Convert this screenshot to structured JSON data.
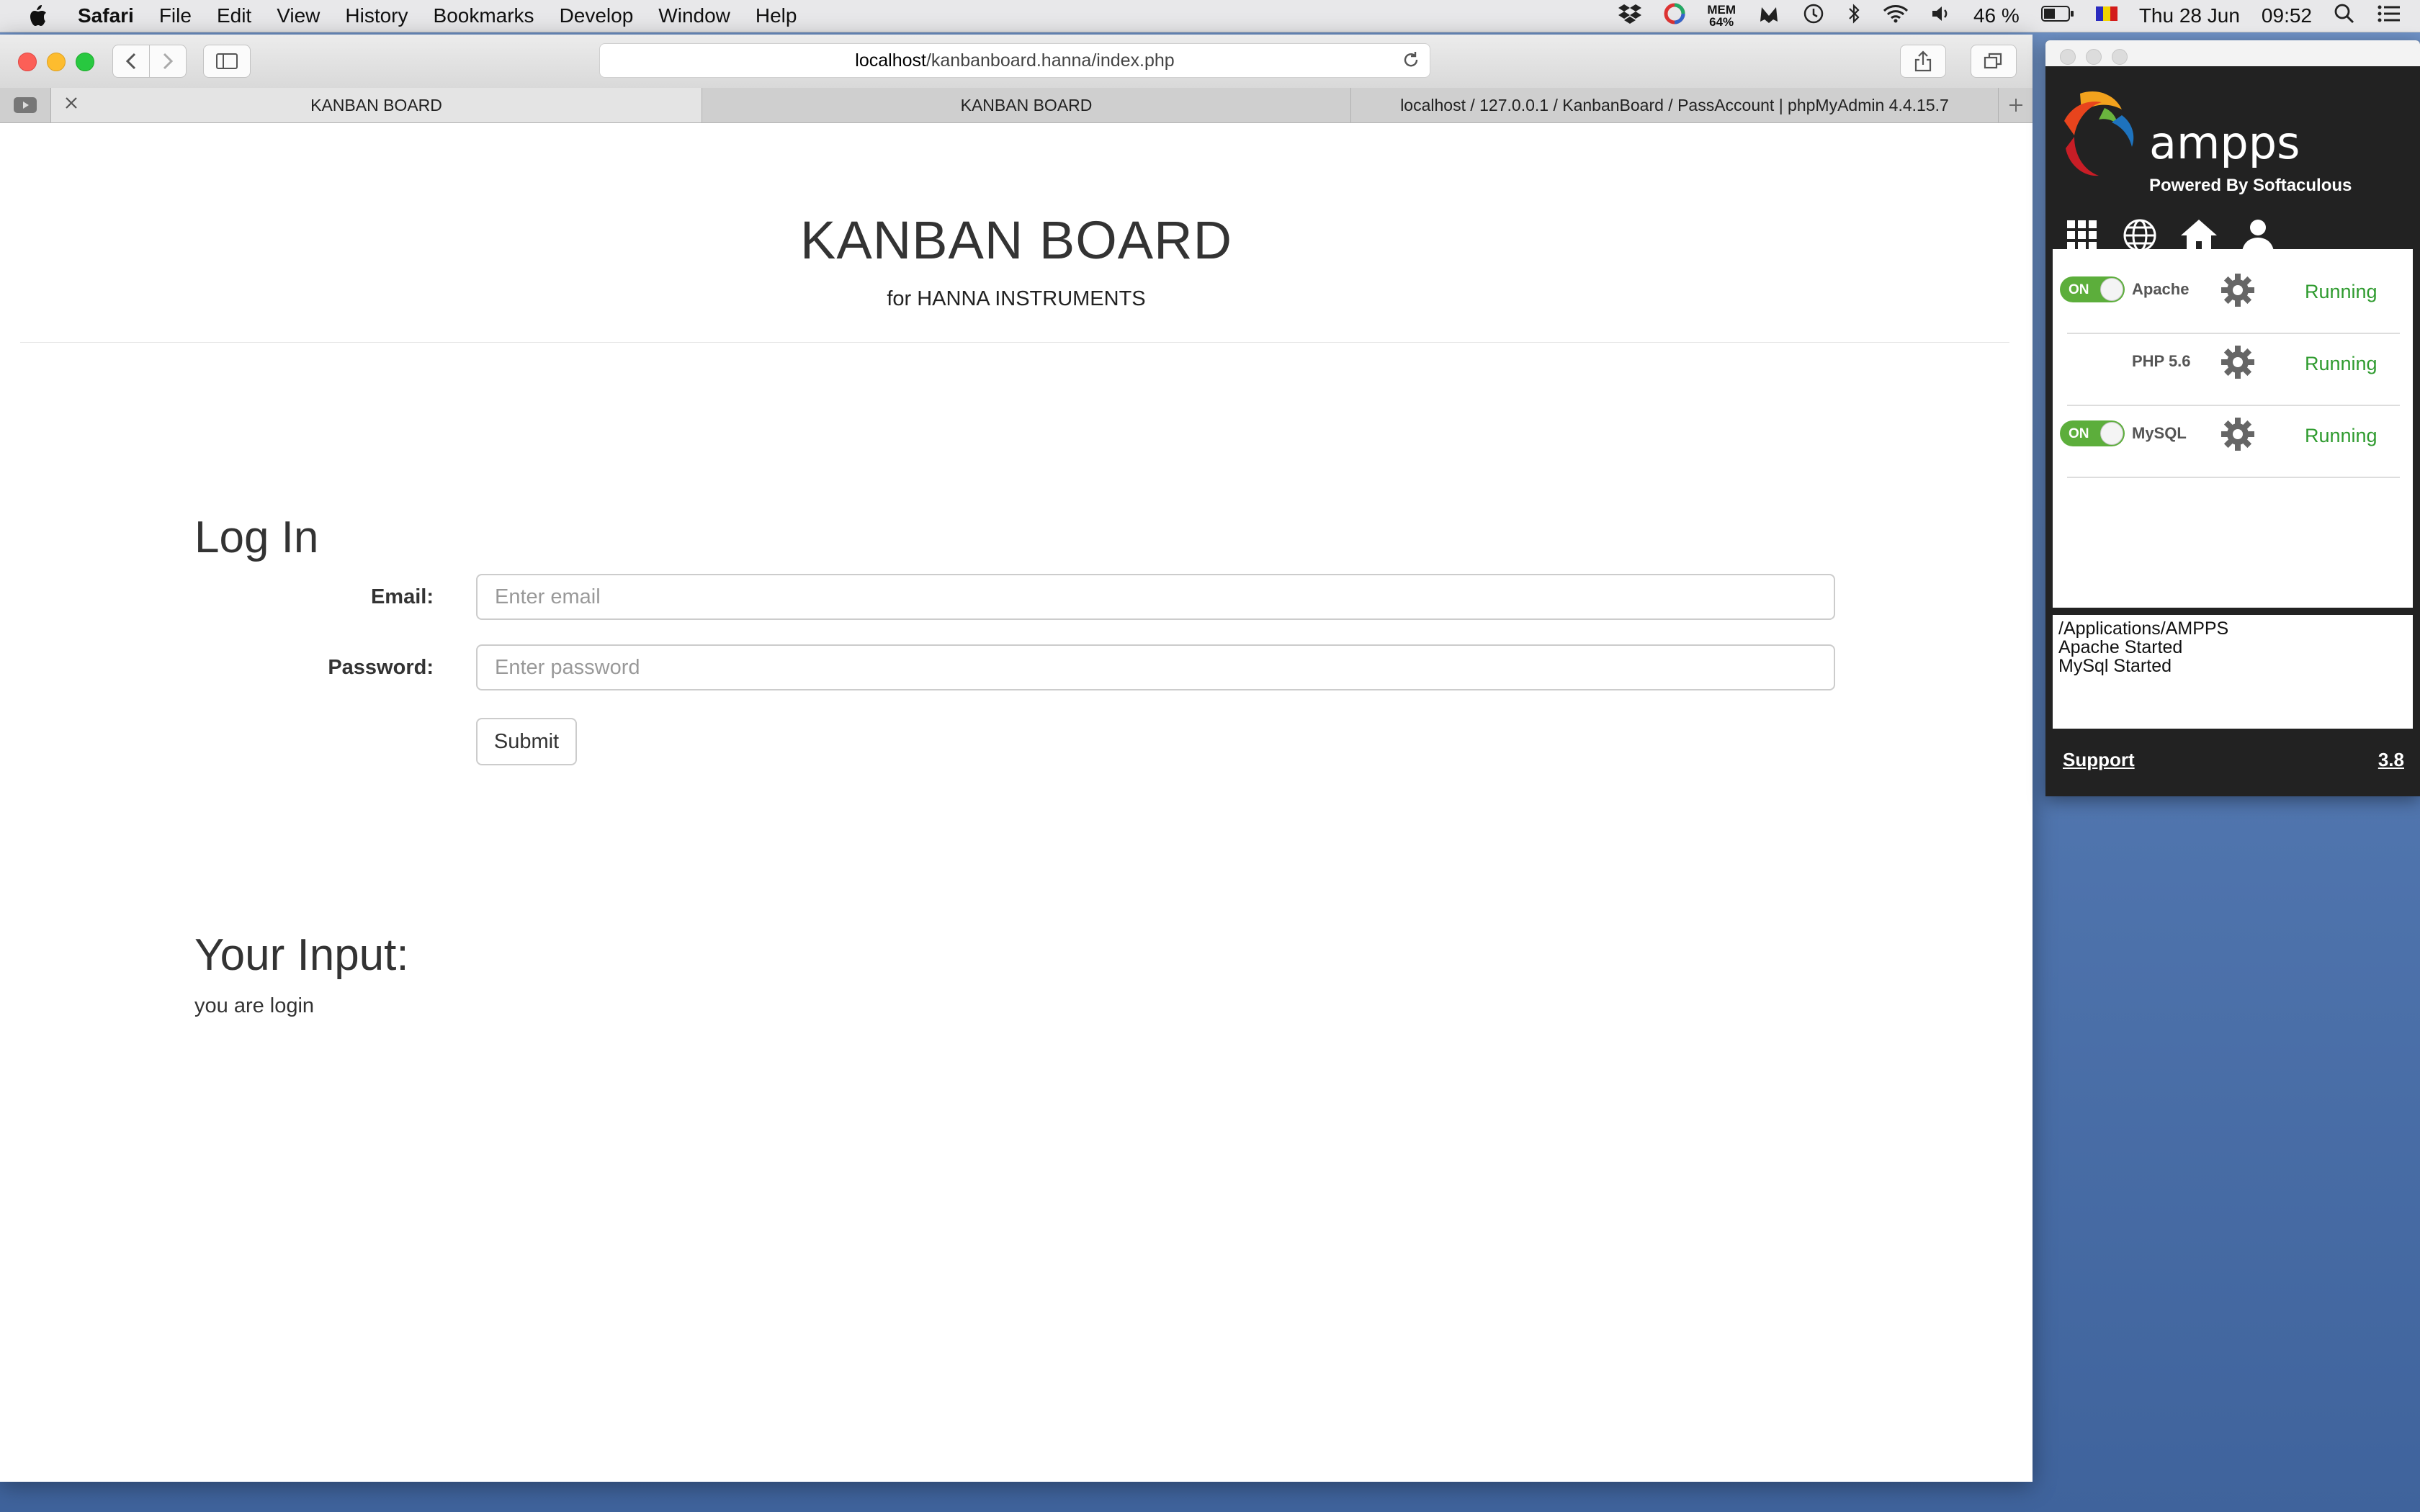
{
  "menubar": {
    "app": "Safari",
    "items": [
      "File",
      "Edit",
      "View",
      "History",
      "Bookmarks",
      "Develop",
      "Window",
      "Help"
    ],
    "mem_label": "MEM",
    "mem_value": "64%",
    "battery": "46 %",
    "date": "Thu 28 Jun",
    "time": "09:52"
  },
  "browser": {
    "url_host": "localhost",
    "url_path": "/kanbanboard.hanna/index.php",
    "tabs": [
      {
        "label": "KANBAN BOARD",
        "active": true
      },
      {
        "label": "KANBAN BOARD",
        "active": false
      },
      {
        "label": "localhost / 127.0.0.1 / KanbanBoard / PassAccount | phpMyAdmin 4.4.15.7",
        "active": false
      }
    ]
  },
  "page": {
    "title": "KANBAN BOARD",
    "subtitle": "for HANNA INSTRUMENTS",
    "login_heading": "Log In",
    "email_label": "Email:",
    "email_placeholder": "Enter email",
    "password_label": "Password:",
    "password_placeholder": "Enter password",
    "submit_label": "Submit",
    "input_heading": "Your Input:",
    "input_text": "you are login"
  },
  "ampps": {
    "name": "ampps",
    "powered_by": "Powered By Softaculous",
    "services": [
      {
        "toggle": "ON",
        "name": "Apache",
        "status": "Running",
        "has_toggle": true
      },
      {
        "toggle": "",
        "name": "PHP 5.6",
        "status": "Running",
        "has_toggle": false
      },
      {
        "toggle": "ON",
        "name": "MySQL",
        "status": "Running",
        "has_toggle": true
      }
    ],
    "log": [
      "/Applications/AMPPS",
      "Apache Started",
      "MySql Started"
    ],
    "support_label": "Support",
    "version": "3.8",
    "status_color": "#2f9b2f"
  }
}
